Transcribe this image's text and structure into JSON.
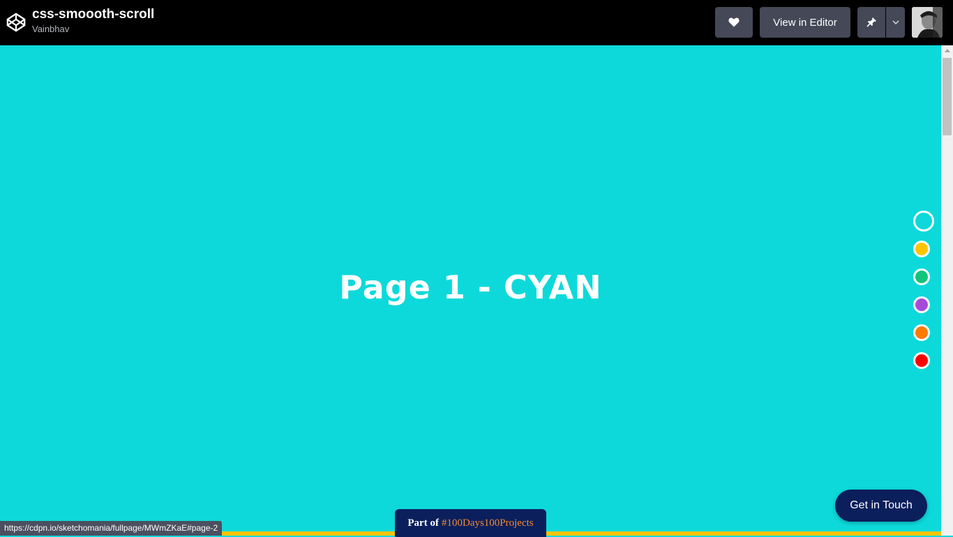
{
  "header": {
    "pen_title": "css-smoooth-scroll",
    "author": "Vainbhav",
    "view_in_editor": "View in Editor"
  },
  "main": {
    "heading": "Page 1 - CYAN",
    "background_color": "#0dd9da"
  },
  "nav_dots": [
    {
      "color": "#0dd9da",
      "active": true
    },
    {
      "color": "#ffc400",
      "active": false
    },
    {
      "color": "#12c47a",
      "active": false
    },
    {
      "color": "#a64ad6",
      "active": false
    },
    {
      "color": "#ff7a00",
      "active": false
    },
    {
      "color": "#ff0000",
      "active": false
    }
  ],
  "footer": {
    "part_of_lead": "Part of",
    "part_of_tag": "#100Days100Projects",
    "get_in_touch": "Get in Touch"
  },
  "status_bar": {
    "url": "https://cdpn.io/sketchomania/fullpage/MWmZKaE#page-2"
  }
}
